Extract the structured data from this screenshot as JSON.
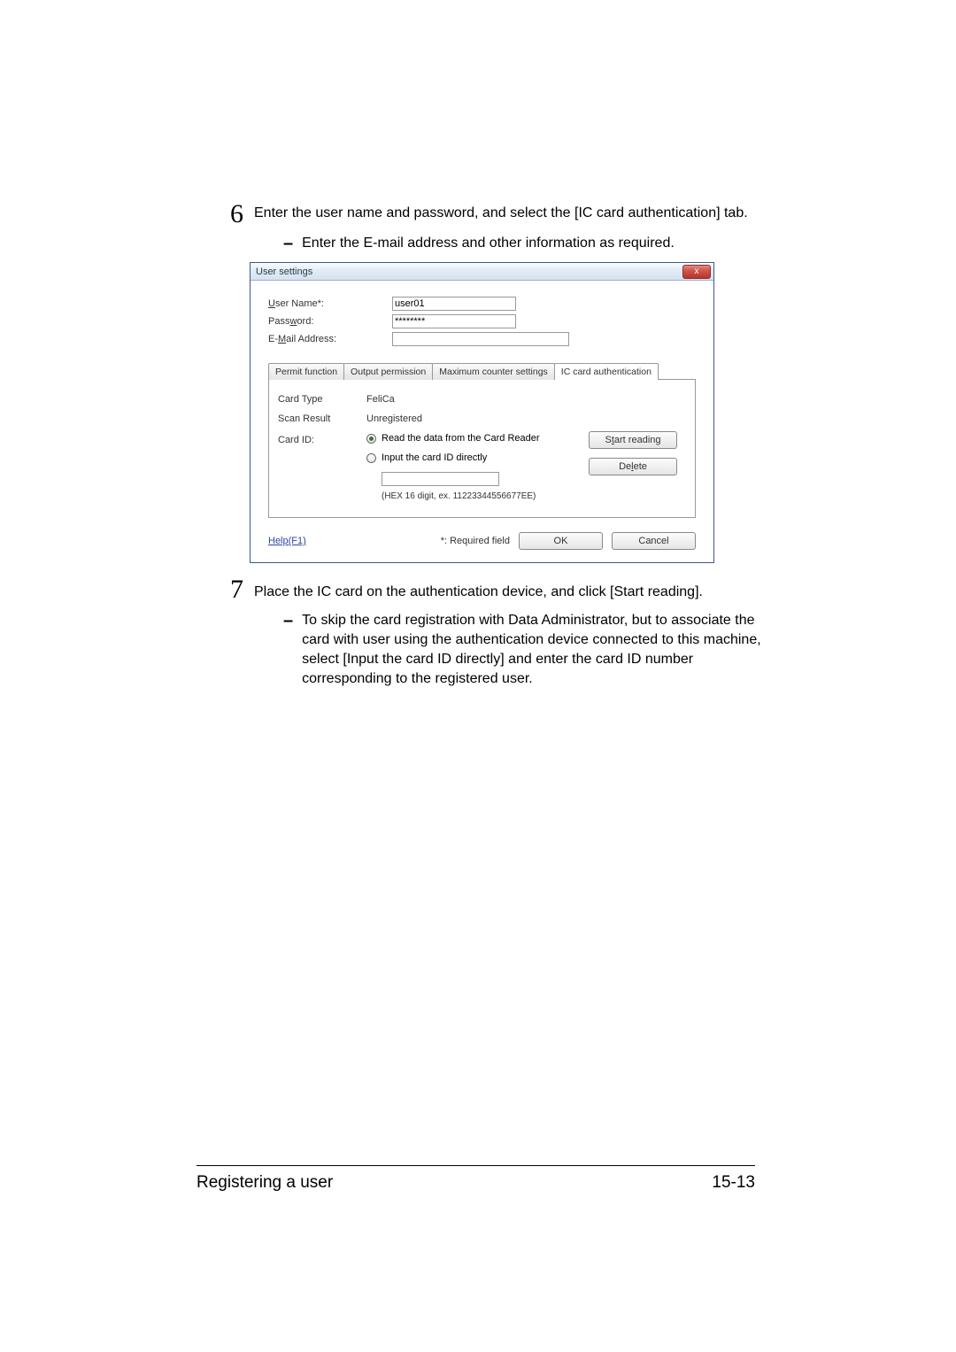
{
  "steps": {
    "six": {
      "number": "6",
      "text": "Enter the user name and password, and select the [IC card authentication] tab.",
      "sub": "Enter the E-mail address and other information as required."
    },
    "seven": {
      "number": "7",
      "text": "Place the IC card on the authentication device, and click [Start reading].",
      "sub": "To skip the card registration with Data Administrator, but to associate the card with user using the authentication device connected to this machine, select [Input the card ID directly] and enter the card ID number corresponding to the registered user."
    }
  },
  "dialog": {
    "title": "User settings",
    "close": "x",
    "labels": {
      "username": "User Name*:",
      "password": "Password:",
      "email": "E-Mail Address:"
    },
    "values": {
      "username": "user01",
      "password": "********"
    },
    "tabs": {
      "permit": "Permit function",
      "output": "Output permission",
      "maxcounter": "Maximum counter settings",
      "iccard": "IC card authentication"
    },
    "tab_content": {
      "card_type_label": "Card Type",
      "card_type_value": "FeliCa",
      "scan_result_label": "Scan Result",
      "scan_result_value": "Unregistered",
      "card_id_label": "Card ID:",
      "radio_read": "Read the data from the Card Reader",
      "radio_input": "Input the card ID directly",
      "hex_note": "(HEX 16 digit, ex. 11223344556677EE)",
      "start_reading": "Start reading",
      "delete": "Delete"
    },
    "footer": {
      "help": "Help(F1)",
      "required": "*: Required field",
      "ok": "OK",
      "cancel": "Cancel"
    }
  },
  "page_footer": {
    "section": "Registering a user",
    "page": "15-13"
  },
  "bullet": "–"
}
